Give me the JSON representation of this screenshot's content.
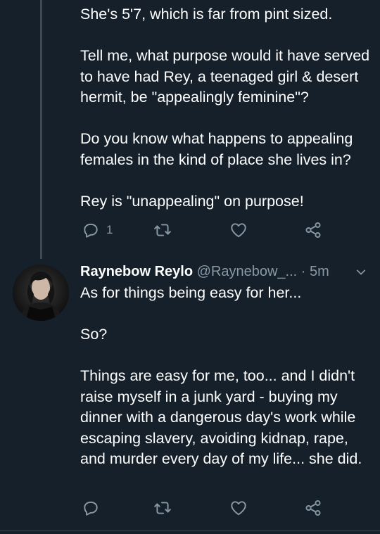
{
  "tweet1": {
    "text": "She's 5'7, which is far from pint sized.\n\nTell me, what purpose would it have served to have had Rey, a teenaged girl & desert hermit, be \"appealingly feminine\"?\n\nDo you know what happens to appealing females in the kind of place she lives in?\n\nRey is \"unappealing\" on purpose!",
    "reply_count": "1"
  },
  "tweet2": {
    "author_name": "Raynebow Reylo",
    "author_handle": "@Raynebow_...",
    "separator": "·",
    "time": "5m",
    "text": "As for things being easy for her...\n\nSo?\n\nThings are easy for me, too... and I didn't raise myself in a junk yard - buying my dinner with a dangerous day's work while escaping slavery, avoiding kidnap, rape, and murder every day of my life... she did."
  },
  "icons": {
    "reply": "reply-icon",
    "retweet": "retweet-icon",
    "like": "heart-icon",
    "share": "share-icon",
    "more": "chevron-down-icon"
  },
  "colors": {
    "background": "#15202b",
    "muted": "#8899a6",
    "thread_line": "#3b4a59"
  }
}
